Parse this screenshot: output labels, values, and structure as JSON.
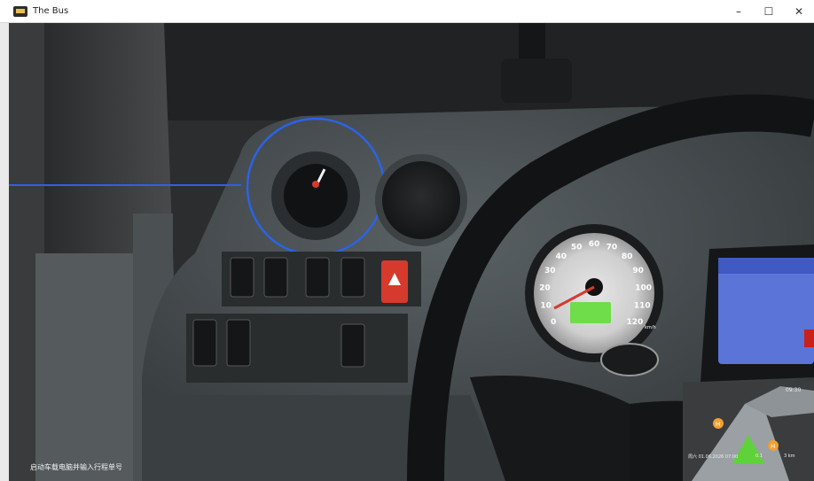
{
  "window": {
    "title": "The Bus",
    "minimize_glyph": "–",
    "maximize_glyph": "☐",
    "close_glyph": "✕"
  },
  "hud": {
    "tutorial_hint": "启动车载电脑并输入行程单号",
    "highlight_color": "#2b63e6"
  },
  "speedometer": {
    "tick_labels": [
      "0",
      "10",
      "20",
      "30",
      "40",
      "50",
      "60",
      "70",
      "80",
      "90",
      "100",
      "110",
      "120"
    ],
    "unit": "km/h",
    "current_speed": 0
  },
  "minimap": {
    "time": "09:30",
    "status_line": "周六 01.06.2026 07:00",
    "speed": "0.1",
    "distance": "3 km",
    "stop_marker": "H"
  },
  "colors": {
    "dashboard": "#3e4446",
    "warning_button": "#d63a2c",
    "display_bg": "#5a74d8",
    "speed_bar": "#6fdc4a"
  }
}
